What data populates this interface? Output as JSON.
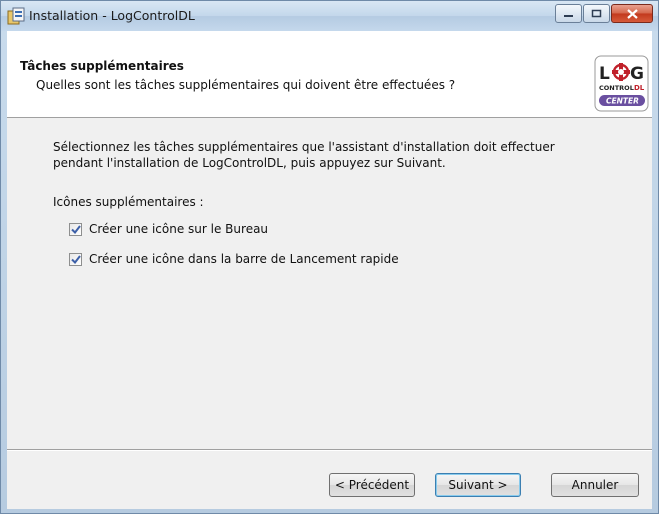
{
  "window": {
    "title": "Installation - LogControlDL"
  },
  "header": {
    "title": "Tâches supplémentaires",
    "subtitle": "Quelles sont les tâches supplémentaires qui doivent être effectuées ?",
    "logo_text": "LOG CONTROL DL CENTER"
  },
  "main": {
    "description_line1": "Sélectionnez les tâches supplémentaires que l'assistant d'installation doit effectuer",
    "description_line2": "pendant l'installation de LogControlDL, puis appuyez sur Suivant.",
    "group_label": "Icônes supplémentaires :",
    "tasks": [
      {
        "label": "Créer une icône sur le Bureau",
        "checked": true
      },
      {
        "label": "Créer une icône dans la barre de Lancement rapide",
        "checked": true
      }
    ]
  },
  "footer": {
    "back_label": "< Précédent",
    "next_label": "Suivant >",
    "cancel_label": "Annuler"
  },
  "colors": {
    "title_bar": "#c3d7eb",
    "close_button": "#c2381d",
    "logo_accent": "#c0202a",
    "logo_band": "#6a4fa0",
    "default_button_border": "#3c7fb1"
  },
  "icons": [
    "setup-app-icon",
    "minimize-icon",
    "maximize-icon",
    "close-icon",
    "checkmark-icon"
  ]
}
